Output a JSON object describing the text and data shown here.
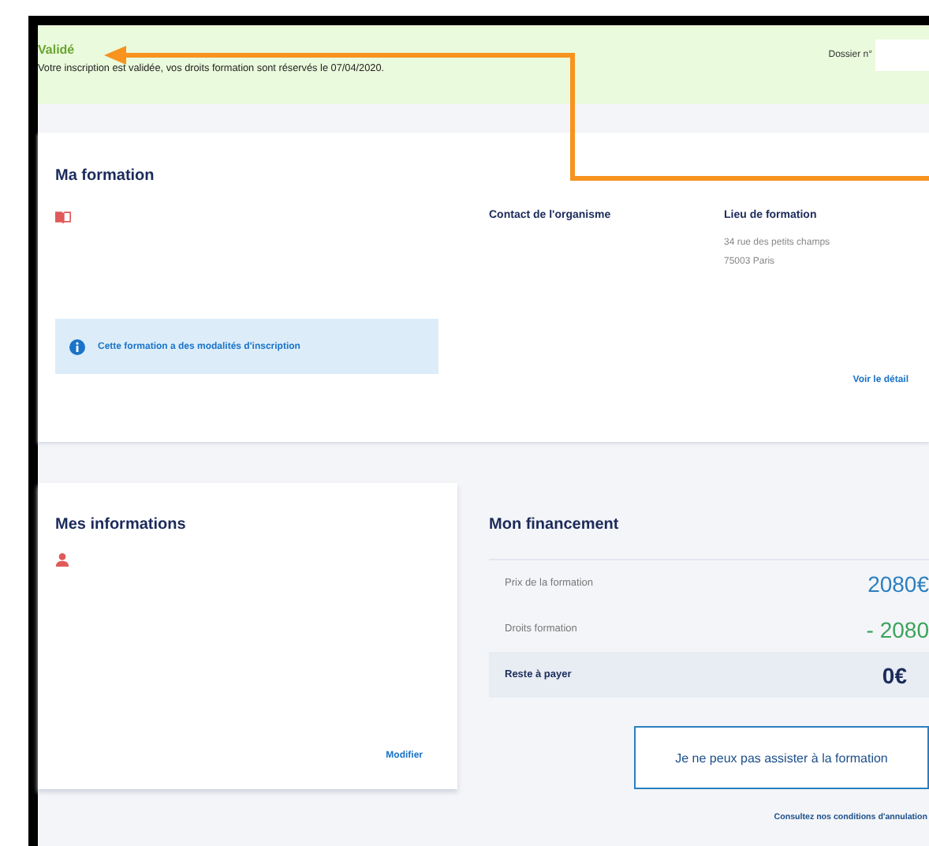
{
  "banner": {
    "status": "Validé",
    "message": "Votre inscription est validée, vos droits formation sont réservés le 07/04/2020.",
    "dossier_label": "Dossier n°"
  },
  "formation": {
    "title": "Ma formation",
    "notice": "Cette formation a des modalités d'inscription",
    "contact_title": "Contact de l'organisme",
    "lieu_title": "Lieu de formation",
    "address": [
      "34 rue des petits champs",
      "75003 Paris"
    ],
    "detail_link": "Voir le détail"
  },
  "informations": {
    "title": "Mes informations",
    "edit_link": "Modifier"
  },
  "financement": {
    "title": "Mon financement",
    "rows": [
      {
        "label": "Prix de la formation",
        "value": "2080€",
        "kind": "price"
      },
      {
        "label": "Droits formation",
        "value": "- 2080",
        "kind": "credit"
      },
      {
        "label": "Reste à payer",
        "value": "0€",
        "kind": "total"
      }
    ],
    "cancel_button": "Je ne peux pas assister à la formation",
    "conditions_link": "Consultez nos conditions d'annulation"
  }
}
